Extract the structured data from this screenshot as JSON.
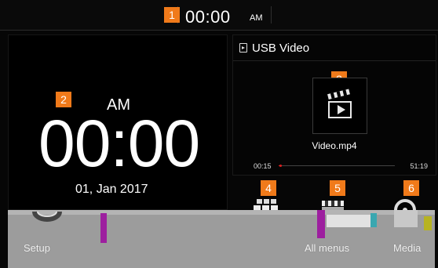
{
  "status_bar": {
    "time": "00:00",
    "ampm": "AM"
  },
  "clock_widget": {
    "ampm": "AM",
    "time": "00:00",
    "date": "01, Jan 2017"
  },
  "media_widget": {
    "source_label": "USB Video",
    "source_icon": "usb-video-icon",
    "thumbnail_icon": "clapperboard-play-icon",
    "filename": "Video.mp4",
    "elapsed": "00:15",
    "total": "51:19",
    "progress_fraction": 0.005
  },
  "callouts": [
    "1",
    "2",
    "3",
    "4",
    "5",
    "6"
  ],
  "dock": {
    "items": [
      {
        "label": "Setup",
        "icon": "gear-icon"
      },
      {
        "label": "All menus",
        "icon": "grid-menu-icon"
      },
      {
        "label": "Media",
        "icon": "media-icon"
      }
    ]
  },
  "colors": {
    "callout": "#f07a1a",
    "progress": "#e02020",
    "accent_magenta": "#9d1f9f"
  }
}
